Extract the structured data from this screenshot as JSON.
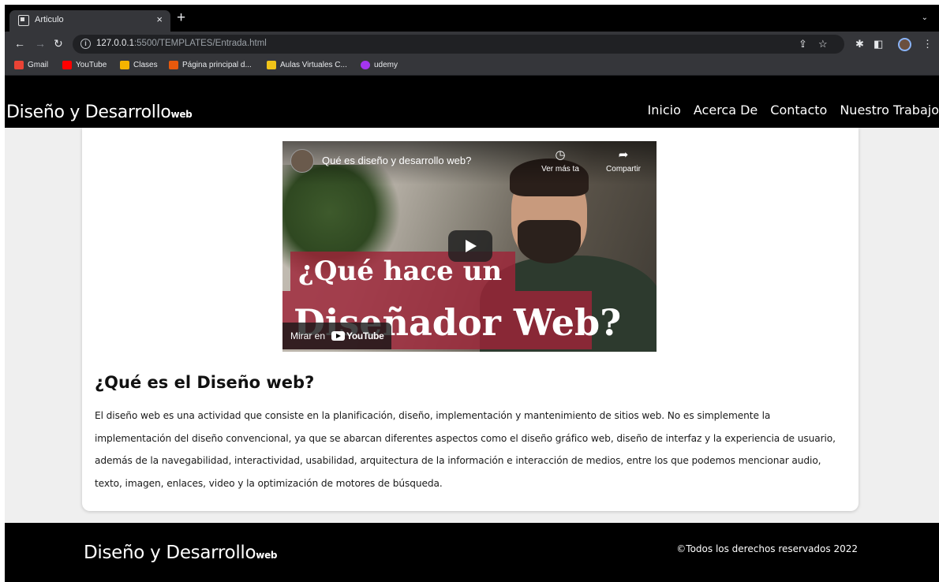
{
  "browser": {
    "tab_title": "Articulo",
    "tab_close": "×",
    "new_tab": "+",
    "tab_menu": "⌄",
    "url_host": "127.0.0.1",
    "url_path": ":5500/TEMPLATES/Entrada.html",
    "bookmarks": [
      {
        "label": "Gmail",
        "icon": "gmail-icon",
        "color": "#ea4335"
      },
      {
        "label": "YouTube",
        "icon": "youtube-icon",
        "color": "#ff0000"
      },
      {
        "label": "Clases",
        "icon": "classroom-icon",
        "color": "#f4b400"
      },
      {
        "label": "Página principal d...",
        "icon": "office-icon",
        "color": "#e8590c"
      },
      {
        "label": "Aulas Virtuales C...",
        "icon": "aulas-icon",
        "color": "#f0c419"
      },
      {
        "label": "udemy",
        "icon": "udemy-icon",
        "color": "#a435f0"
      }
    ]
  },
  "header": {
    "logo_main": "Diseño y Desarrollo",
    "logo_sub": "web",
    "nav": [
      "Inicio",
      "Acerca De",
      "Contacto",
      "Nuestro Trabajo"
    ]
  },
  "video": {
    "title": "Qué es diseño y desarrollo web?",
    "watch_later": "Ver más ta",
    "share": "Compartir",
    "overlay_line1": "¿Qué hace un",
    "overlay_line2": "Diseñador Web?",
    "watch_on": "Mirar en",
    "youtube_logo": "YouTube"
  },
  "article": {
    "title": "¿Qué es el Diseño web?",
    "body": "El diseño web es una actividad que consiste en la planificación, diseño, implementación y mantenimiento de sitios web. No es simplemente la implementación del diseño convencional, ya que se abarcan diferentes aspectos como el diseño gráfico web, diseño de interfaz y la experiencia de usuario, además de la navegabilidad, interactividad, usabilidad, arquitectura de la información e interacción de medios, entre los que podemos mencionar audio, texto, imagen, enlaces, video y la optimización de motores de búsqueda."
  },
  "footer": {
    "logo_main": "Diseño y Desarrollo",
    "logo_sub": "web",
    "copyright": "©Todos los derechos reservados 2022"
  },
  "colors": {
    "header_bg": "#000000",
    "page_bg": "#efefef",
    "card_bg": "#ffffff",
    "video_overlay": "#9e2438"
  }
}
